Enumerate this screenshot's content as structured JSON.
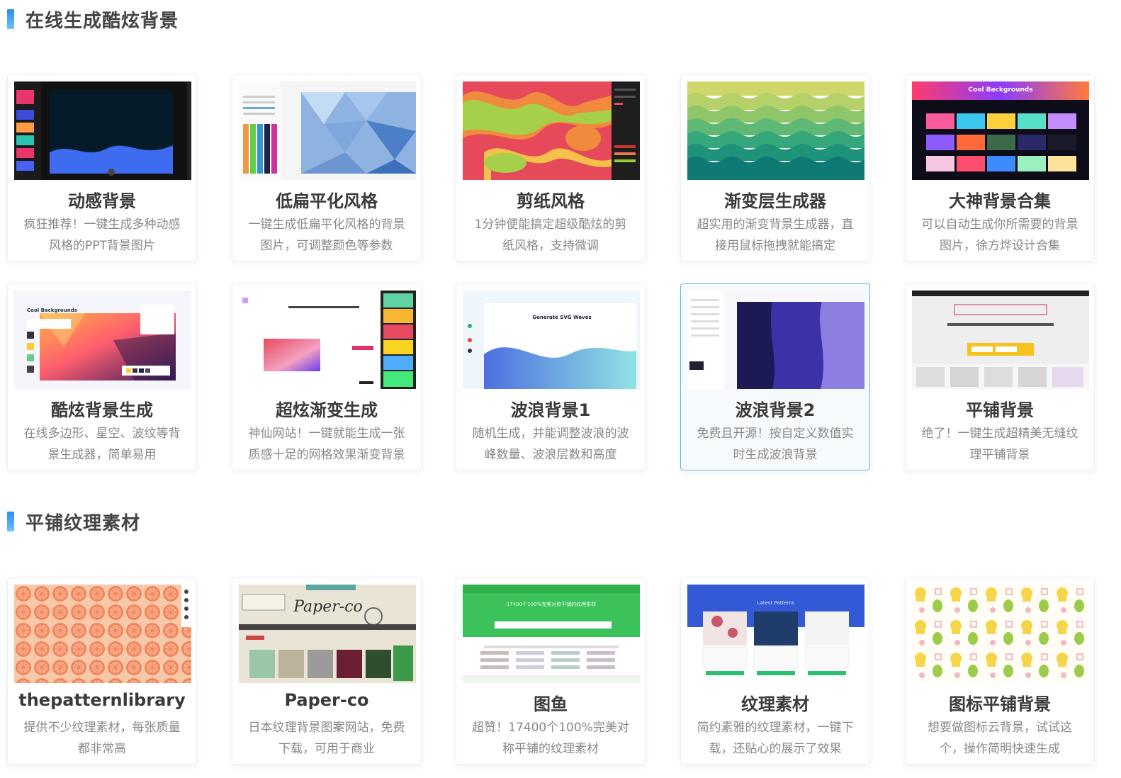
{
  "sections": [
    {
      "title": "在线生成酷炫背景",
      "cards": [
        {
          "title": "动感背景",
          "desc": "疯狂推荐！一键生成多种动感风格的PPT背景图片"
        },
        {
          "title": "低扁平化风格",
          "desc": "一键生成低扁平化风格的背景图片，可调整颜色等参数"
        },
        {
          "title": "剪纸风格",
          "desc": "1分钟便能搞定超级酷炫的剪纸风格，支持微调"
        },
        {
          "title": "渐变层生成器",
          "desc": "超实用的渐变背景生成器，直接用鼠标拖拽就能搞定"
        },
        {
          "title": "大神背景合集",
          "desc": "可以自动生成你所需要的背景图片，徐方烨设计合集",
          "thumb_text": "Cool Backgrounds"
        },
        {
          "title": "酷炫背景生成",
          "desc": "在线多边形、星空、波纹等背景生成器，简单易用",
          "thumb_text": "Cool Backgrounds"
        },
        {
          "title": "超炫渐变生成",
          "desc": "神仙网站！一键就能生成一张质感十足的网格效果渐变背景"
        },
        {
          "title": "波浪背景1",
          "desc": "随机生成，并能调整波浪的波峰数量、波浪层数和高度",
          "thumb_text": "Generate SVG Waves"
        },
        {
          "title": "波浪背景2",
          "desc": "免费且开源！按自定义数值实时生成波浪背景"
        },
        {
          "title": "平铺背景",
          "desc": "绝了！一键生成超精美无缝纹理平铺背景"
        }
      ]
    },
    {
      "title": "平铺纹理素材",
      "cards": [
        {
          "title": "thepatternlibrary",
          "desc": "提供不少纹理素材，每张质量都非常高"
        },
        {
          "title": "Paper-co",
          "desc": "日本纹理背景图案网站，免费下载，可用于商业",
          "thumb_text": "Paper-co"
        },
        {
          "title": "图鱼",
          "desc": "超赞！17400个100%完美对称平铺的纹理素材",
          "thumb_text": "17400个100%完美对称平铺的纹理素材"
        },
        {
          "title": "纹理素材",
          "desc": "简约素雅的纹理素材，一键下载，还贴心的展示了效果",
          "thumb_text": "Latest Patterns"
        },
        {
          "title": "图标平铺背景",
          "desc": "想要做图标云背景，试试这个，操作简明快速生成"
        }
      ]
    }
  ],
  "colors": {
    "accent": "#2b8cf0",
    "highlight_border": "#6ab8d8",
    "title_text": "#3a3a3a",
    "desc_text": "#888888"
  }
}
